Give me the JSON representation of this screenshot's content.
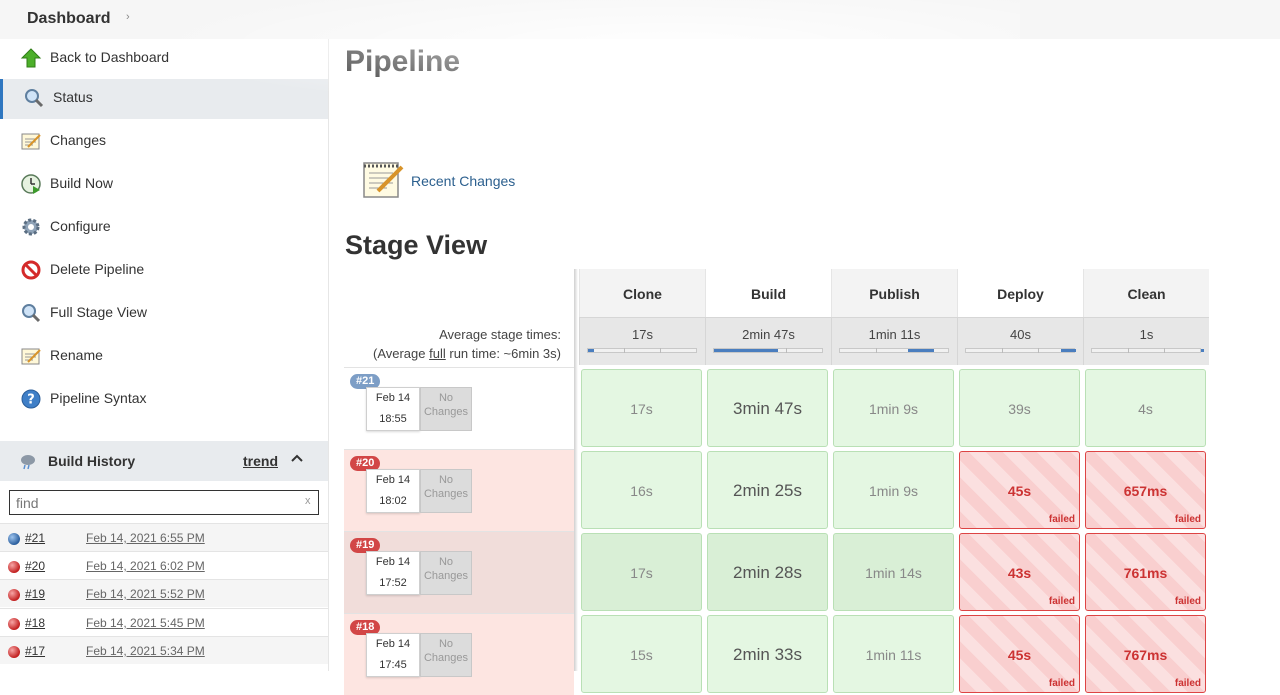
{
  "breadcrumb": {
    "root": "Dashboard",
    "arrow": "›"
  },
  "sidebar": {
    "tasks": [
      {
        "label": "Back to Dashboard",
        "icon": "up-arrow-icon"
      },
      {
        "label": "Status",
        "icon": "search-icon"
      },
      {
        "label": "Changes",
        "icon": "notepad-icon"
      },
      {
        "label": "Build Now",
        "icon": "clock-play-icon"
      },
      {
        "label": "Configure",
        "icon": "gear-icon"
      },
      {
        "label": "Delete Pipeline",
        "icon": "no-entry-icon"
      },
      {
        "label": "Full Stage View",
        "icon": "search-icon"
      },
      {
        "label": "Rename",
        "icon": "notepad-icon"
      },
      {
        "label": "Pipeline Syntax",
        "icon": "help-icon"
      }
    ],
    "build_history": {
      "title": "Build History",
      "trend": "trend",
      "find_placeholder": "find",
      "clear": "x",
      "builds": [
        {
          "num": "#21",
          "date": "Feb 14, 2021 6:55 PM",
          "status": "blue"
        },
        {
          "num": "#20",
          "date": "Feb 14, 2021 6:02 PM",
          "status": "red"
        },
        {
          "num": "#19",
          "date": "Feb 14, 2021 5:52 PM",
          "status": "red"
        },
        {
          "num": "#18",
          "date": "Feb 14, 2021 5:45 PM",
          "status": "red"
        },
        {
          "num": "#17",
          "date": "Feb 14, 2021 5:34 PM",
          "status": "red"
        }
      ]
    }
  },
  "main": {
    "title": "Pipeline",
    "recent_changes": "Recent Changes",
    "stage_view_title": "Stage View",
    "avg_label_1": "Average stage times:",
    "avg_label_2a": "(Average ",
    "avg_label_full": "full",
    "avg_label_2b": " run time: ~6min 3s)",
    "no_changes": "No Changes",
    "failed_label": "failed",
    "stages": [
      {
        "name": "Clone",
        "avg": "17s",
        "bar_start": 0.0,
        "bar_fraction": 0.05
      },
      {
        "name": "Build",
        "avg": "2min 47s",
        "bar_start": 0.0,
        "bar_fraction": 0.58
      },
      {
        "name": "Publish",
        "avg": "1min 11s",
        "bar_start": 0.62,
        "bar_fraction": 0.24
      },
      {
        "name": "Deploy",
        "avg": "40s",
        "bar_start": 0.86,
        "bar_fraction": 0.14
      },
      {
        "name": "Clean",
        "avg": "1s",
        "bar_start": 0.99,
        "bar_fraction": 0.01
      }
    ],
    "runs": [
      {
        "num": "#21",
        "date": "Feb 14",
        "time": "18:55",
        "status": "success",
        "cells": [
          "17s",
          "3min 47s",
          "1min 9s",
          "39s",
          "4s"
        ],
        "failed": [
          false,
          false,
          false,
          false,
          false
        ]
      },
      {
        "num": "#20",
        "date": "Feb 14",
        "time": "18:02",
        "status": "failed",
        "cells": [
          "16s",
          "2min 25s",
          "1min 9s",
          "45s",
          "657ms"
        ],
        "failed": [
          false,
          false,
          false,
          true,
          true
        ]
      },
      {
        "num": "#19",
        "date": "Feb 14",
        "time": "17:52",
        "status": "failed",
        "cells": [
          "17s",
          "2min 28s",
          "1min 14s",
          "43s",
          "761ms"
        ],
        "failed": [
          false,
          false,
          false,
          true,
          true
        ]
      },
      {
        "num": "#18",
        "date": "Feb 14",
        "time": "17:45",
        "status": "failed",
        "cells": [
          "15s",
          "2min 33s",
          "1min 11s",
          "45s",
          "767ms"
        ],
        "failed": [
          false,
          false,
          false,
          true,
          true
        ]
      }
    ]
  }
}
